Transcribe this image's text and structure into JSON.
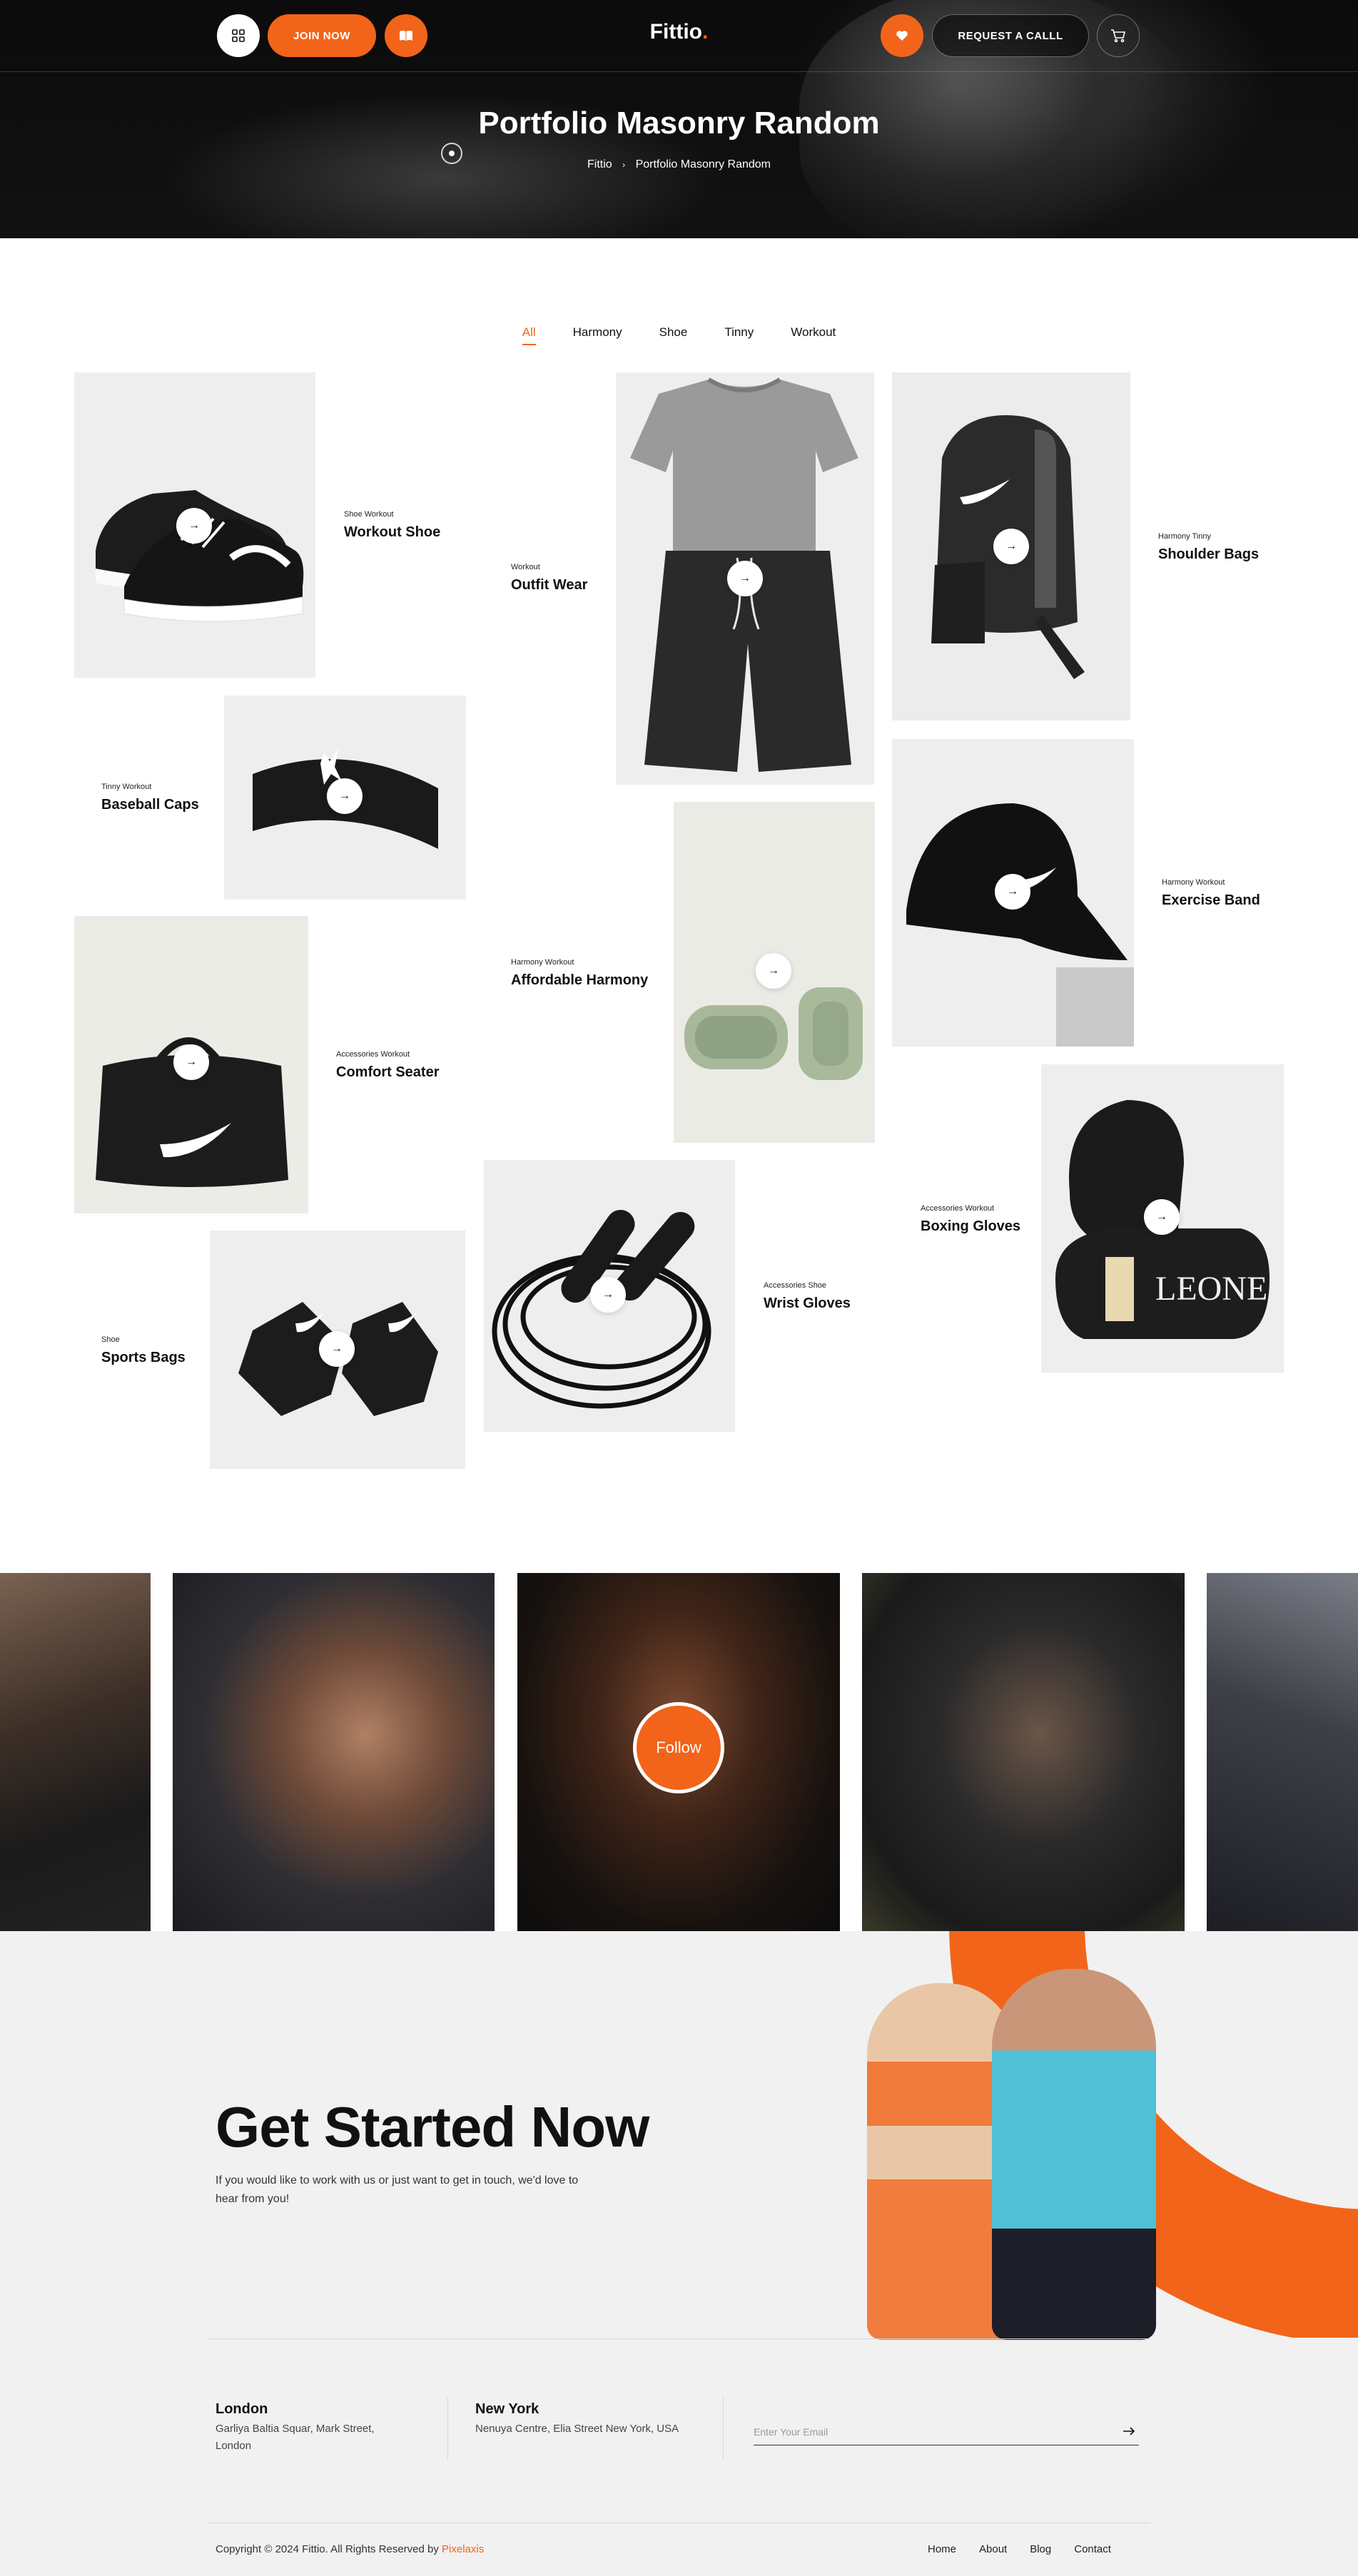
{
  "colors": {
    "accent": "#f26419",
    "dark": "#0b0b0b",
    "tile_bg": "#eeeeee"
  },
  "header": {
    "menu_icon": "grid-icon",
    "join_label": "JOIN NOW",
    "book_icon": "book-icon",
    "logo_text": "Fittio",
    "logo_dot": ".",
    "heart_icon": "heart-icon",
    "request_label": "REQUEST A CALLL",
    "cart_icon": "cart-icon"
  },
  "hero": {
    "title": "Portfolio Masonry Random",
    "breadcrumb": [
      "Fittio",
      "Portfolio Masonry Random"
    ],
    "breadcrumb_sep": "›"
  },
  "filters": [
    "All",
    "Harmony",
    "Shoe",
    "Tinny",
    "Workout"
  ],
  "filters_active": "All",
  "portfolio": [
    {
      "category": "Shoe Workout",
      "title": "Workout Shoe",
      "image": "sneakers"
    },
    {
      "category": "Workout",
      "title": "Outfit Wear",
      "image": "tshirt-shorts"
    },
    {
      "category": "Harmony Tinny",
      "title": "Shoulder Bags",
      "image": "backpack"
    },
    {
      "category": "Tinny Workout",
      "title": "Baseball Caps",
      "image": "headband"
    },
    {
      "category": "Harmony Workout",
      "title": "Exercise Band",
      "image": "cap"
    },
    {
      "category": "Harmony Workout",
      "title": "Affordable Harmony",
      "image": "ankle-weights"
    },
    {
      "category": "Accessories Workout",
      "title": "Comfort Seater",
      "image": "duffel-bag"
    },
    {
      "category": "Accessories Workout",
      "title": "Boxing Gloves",
      "image": "boxing-gloves"
    },
    {
      "category": "Accessories Shoe",
      "title": "Wrist Gloves",
      "image": "jump-rope"
    },
    {
      "category": "Shoe",
      "title": "Sports Bags",
      "image": "knee-pads"
    }
  ],
  "gallery": {
    "follow_label": "Follow"
  },
  "cta": {
    "title": "Get Started Now",
    "text": "If you would like to work with us or just want to get in touch, we'd love to hear from you!"
  },
  "offices": [
    {
      "city": "London",
      "address": "Garliya Baltia Squar, Mark Street, London"
    },
    {
      "city": "New York",
      "address": "Nenuya Centre, Elia Street New York, USA"
    }
  ],
  "newsletter": {
    "placeholder": "Enter Your Email"
  },
  "footer": {
    "copyright": "Copyright © 2024 Fittio. All Rights Reserved by ",
    "brand": "Pixelaxis",
    "links": [
      "Home",
      "About",
      "Blog",
      "Contact"
    ]
  }
}
